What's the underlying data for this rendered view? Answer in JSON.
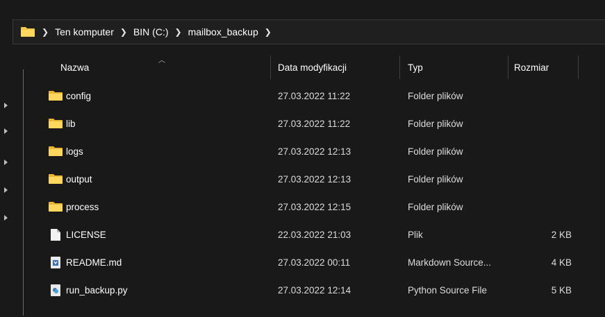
{
  "address": {
    "crumbs": [
      "Ten komputer",
      "BIN (C:)",
      "mailbox_backup"
    ]
  },
  "columns": {
    "name": "Nazwa",
    "date": "Data modyfikacji",
    "type": "Typ",
    "size": "Rozmiar"
  },
  "files": [
    {
      "name": "config",
      "date": "27.03.2022 11:22",
      "type": "Folder plików",
      "size": "",
      "icon": "folder-icon"
    },
    {
      "name": "lib",
      "date": "27.03.2022 11:22",
      "type": "Folder plików",
      "size": "",
      "icon": "folder-icon"
    },
    {
      "name": "logs",
      "date": "27.03.2022 12:13",
      "type": "Folder plików",
      "size": "",
      "icon": "folder-icon"
    },
    {
      "name": "output",
      "date": "27.03.2022 12:13",
      "type": "Folder plików",
      "size": "",
      "icon": "folder-icon"
    },
    {
      "name": "process",
      "date": "27.03.2022 12:15",
      "type": "Folder plików",
      "size": "",
      "icon": "folder-icon"
    },
    {
      "name": "LICENSE",
      "date": "22.03.2022 21:03",
      "type": "Plik",
      "size": "2 KB",
      "icon": "file-icon"
    },
    {
      "name": "README.md",
      "date": "27.03.2022 00:11",
      "type": "Markdown Source...",
      "size": "4 KB",
      "icon": "markdown-file-icon"
    },
    {
      "name": "run_backup.py",
      "date": "27.03.2022 12:14",
      "type": "Python Source File",
      "size": "5 KB",
      "icon": "python-file-icon"
    }
  ],
  "colors": {
    "background": "#191919",
    "folder": "#f4c84a",
    "separator": "#3f3f3f"
  }
}
